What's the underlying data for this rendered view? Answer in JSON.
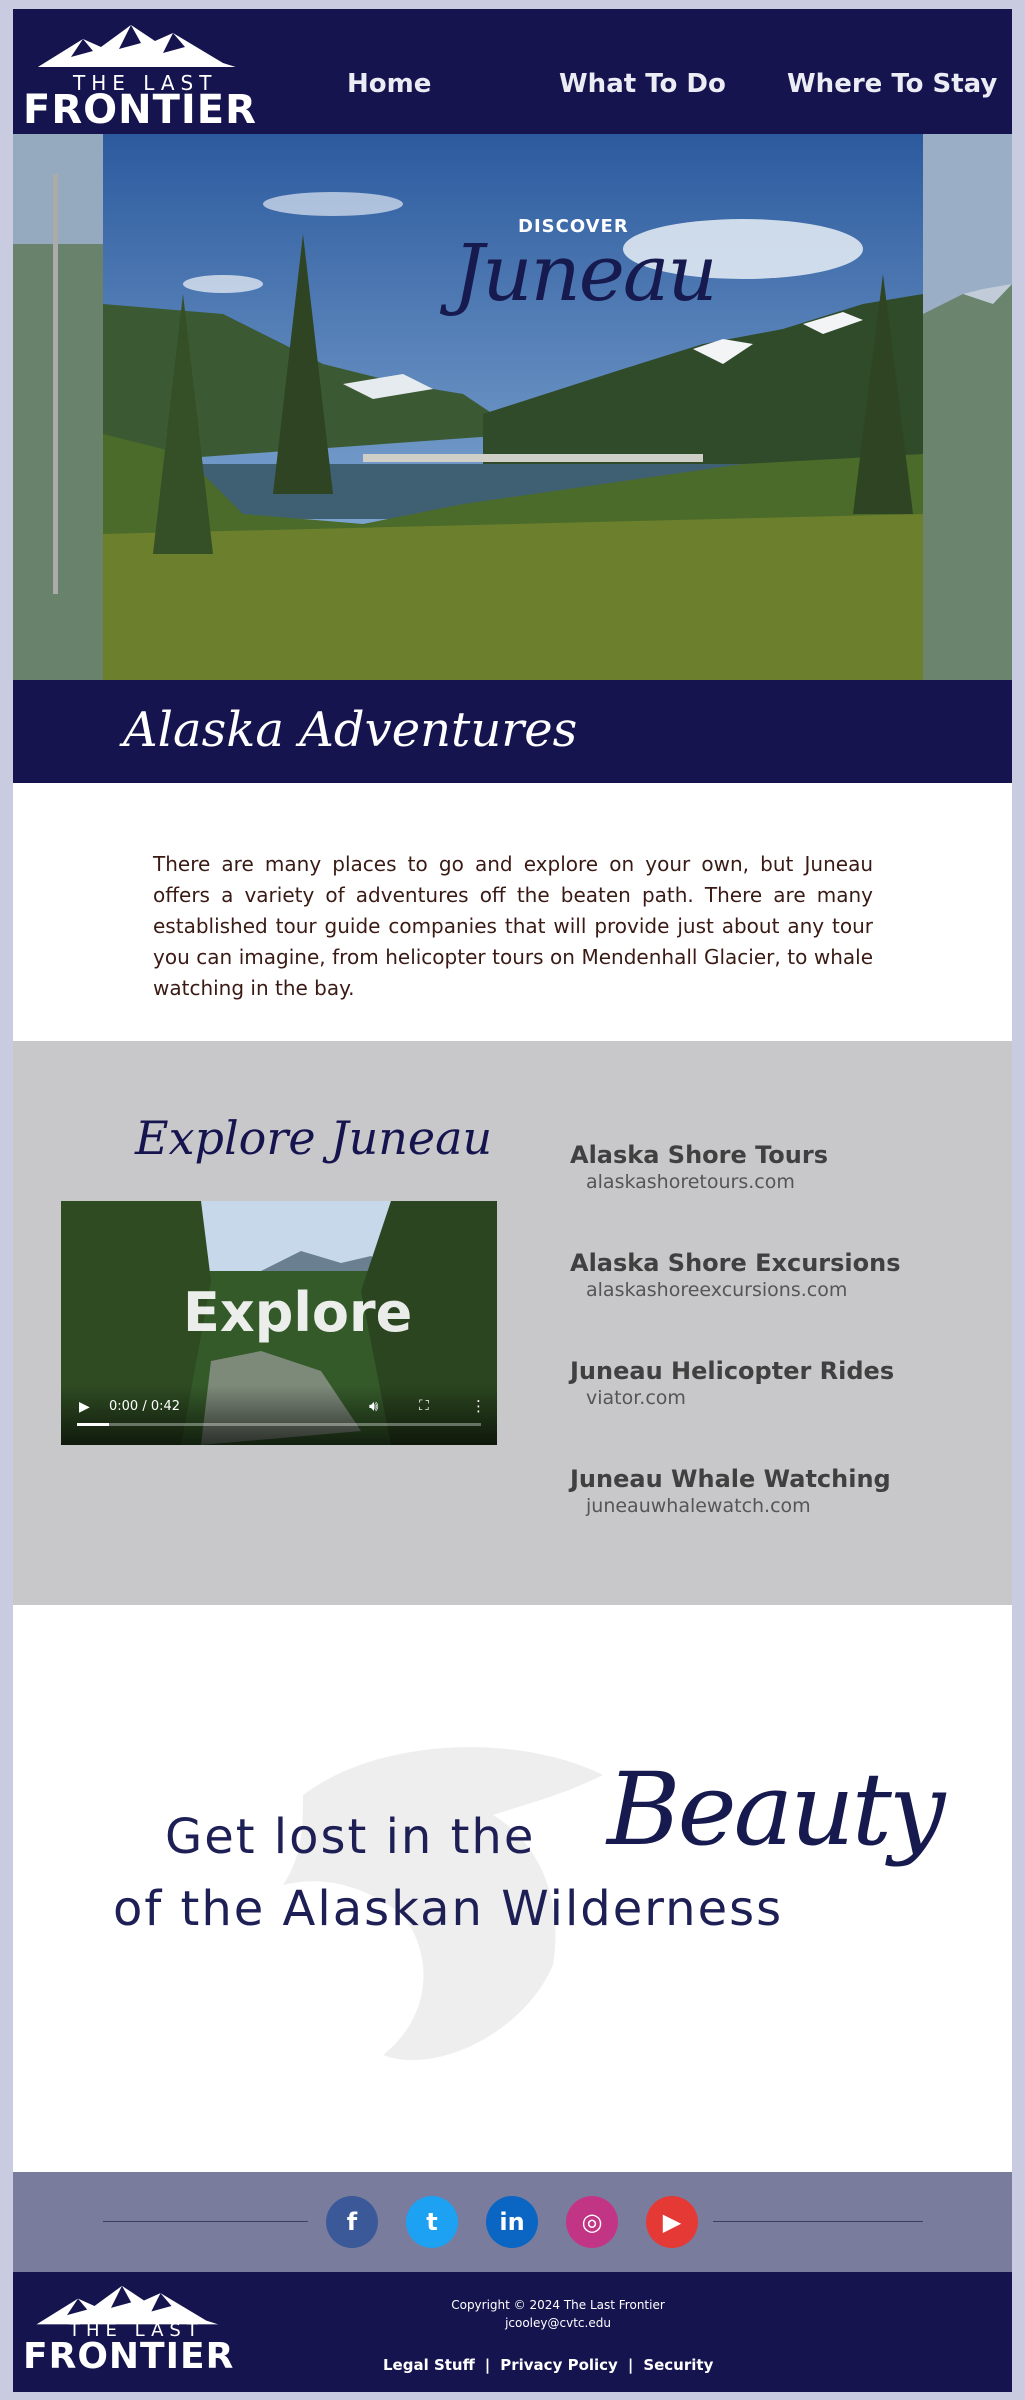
{
  "header": {
    "logo_line1": "THE LAST",
    "logo_line2": "FRONTIER",
    "nav": [
      "Home",
      "What To Do",
      "Where To Stay"
    ]
  },
  "hero": {
    "discover": "DISCOVER",
    "city": "Juneau"
  },
  "band": {
    "title": "Alaska Adventures"
  },
  "intro": {
    "text": "There are many places to go and explore on your own, but Juneau offers a variety of adventures off the beaten path. There are many established tour guide companies that will provide just about any tour you can imagine, from helicopter tours on Mendenhall Glacier, to whale watching in the bay."
  },
  "explore": {
    "title": "Explore Juneau",
    "video": {
      "caption": "Explore",
      "time": "0:00 / 0:42",
      "progress": 0.08
    },
    "tours": [
      {
        "name": "Alaska Shore Tours",
        "url": "alaskashoretours.com"
      },
      {
        "name": "Alaska Shore Excursions",
        "url": "alaskashoreexcursions.com"
      },
      {
        "name": "Juneau Helicopter Rides",
        "url": "viator.com"
      },
      {
        "name": "Juneau Whale Watching",
        "url": "juneauwhalewatch.com"
      }
    ]
  },
  "beauty": {
    "line1": "Get lost in the",
    "word": "Beauty",
    "line2": "of the Alaskan Wilderness"
  },
  "social": {
    "icons": [
      {
        "name": "facebook-icon",
        "glyph": "f",
        "color": "#3b5998"
      },
      {
        "name": "twitter-icon",
        "glyph": "t",
        "color": "#1da1f2"
      },
      {
        "name": "linkedin-icon",
        "glyph": "in",
        "color": "#0a66c2"
      },
      {
        "name": "instagram-icon",
        "glyph": "◎",
        "color": "#c13584"
      },
      {
        "name": "youtube-icon",
        "glyph": "▶",
        "color": "#e53935"
      }
    ]
  },
  "footer": {
    "logo_line1": "THE LAST",
    "logo_line2": "FRONTIER",
    "copyright": "Copyright © 2024 The Last Frontier",
    "email": "jcooley@cvtc.edu",
    "links": [
      "Legal Stuff",
      "Privacy Policy",
      "Security"
    ]
  },
  "colors": {
    "navy": "#16144f",
    "grey_section": "#c8c8ca",
    "social_band": "#7a7c9e",
    "page_bg": "#c9cbe0"
  }
}
